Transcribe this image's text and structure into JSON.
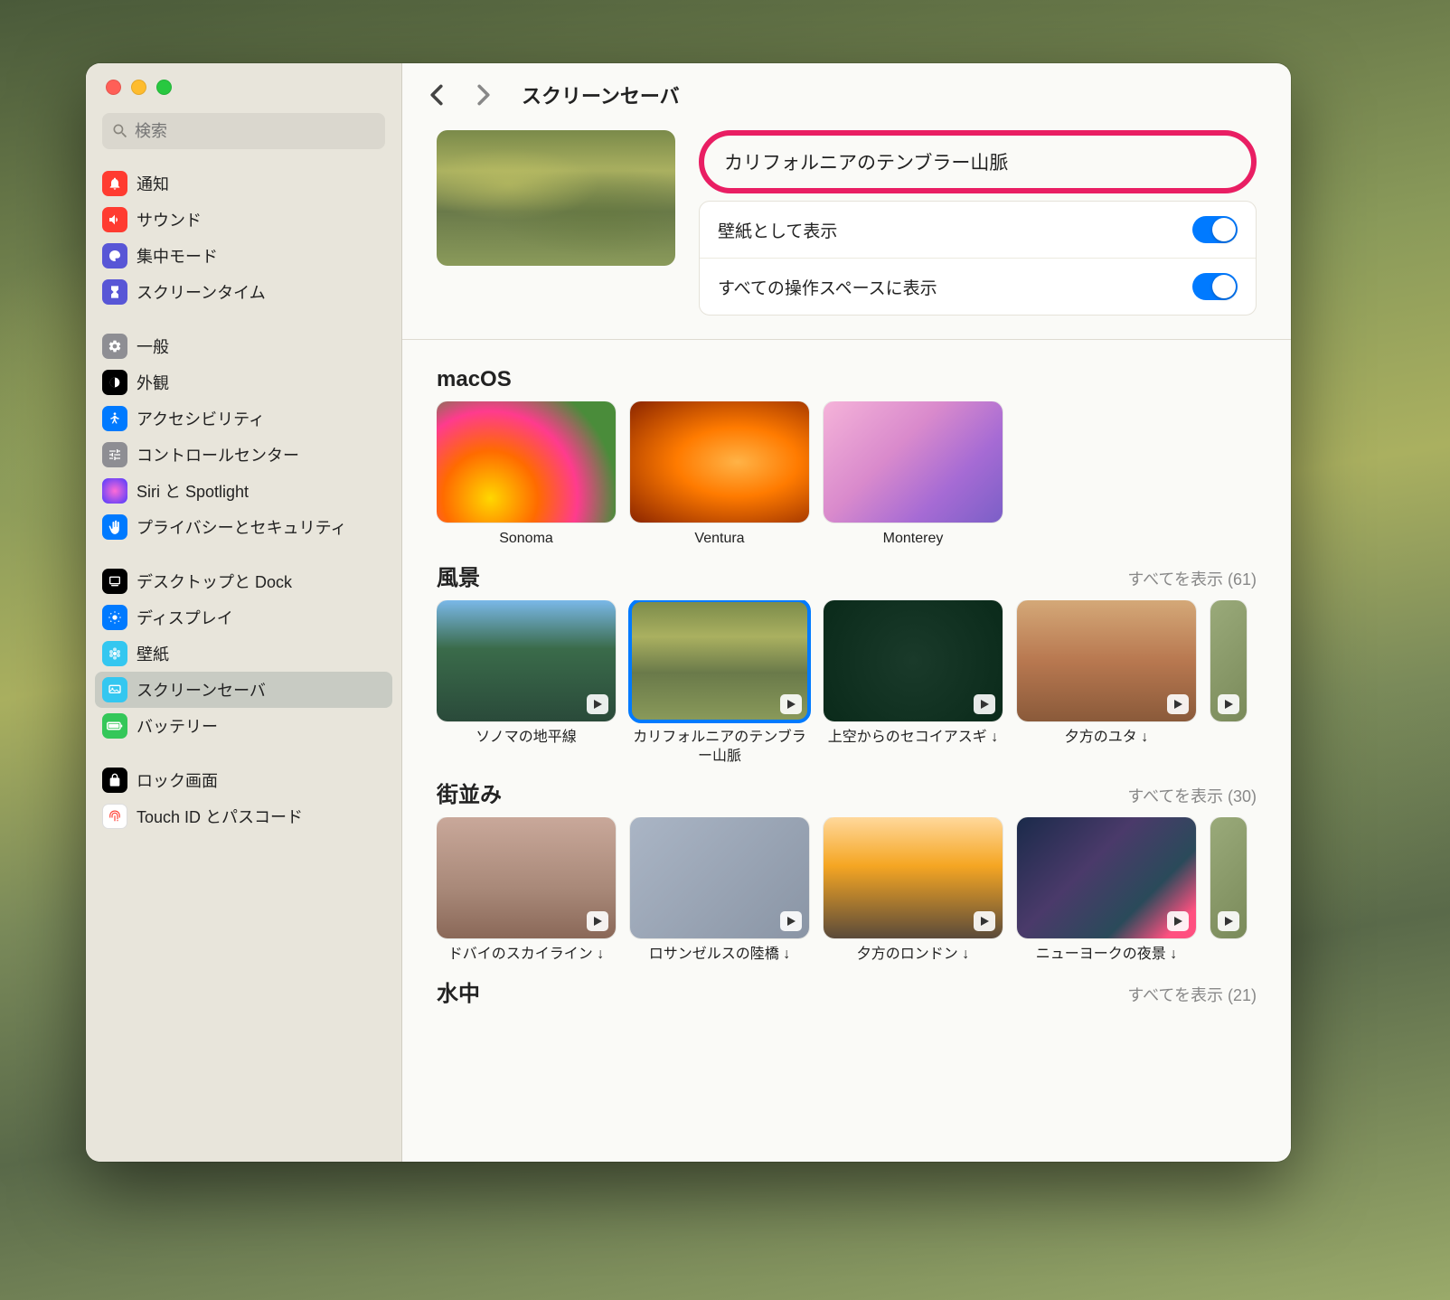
{
  "search": {
    "placeholder": "検索"
  },
  "header": {
    "title": "スクリーンセーバ"
  },
  "sidebar": {
    "items": [
      {
        "label": "通知",
        "icon_bg": "#ff3b30"
      },
      {
        "label": "サウンド",
        "icon_bg": "#ff3b30"
      },
      {
        "label": "集中モード",
        "icon_bg": "#5856d6"
      },
      {
        "label": "スクリーンタイム",
        "icon_bg": "#5856d6"
      },
      {
        "label": "一般",
        "icon_bg": "#8e8e93"
      },
      {
        "label": "外観",
        "icon_bg": "#000000"
      },
      {
        "label": "アクセシビリティ",
        "icon_bg": "#007aff"
      },
      {
        "label": "コントロールセンター",
        "icon_bg": "#8e8e93"
      },
      {
        "label": "Siri と Spotlight",
        "icon_bg": "#000000"
      },
      {
        "label": "プライバシーとセキュリティ",
        "icon_bg": "#007aff"
      },
      {
        "label": "デスクトップと Dock",
        "icon_bg": "#000000"
      },
      {
        "label": "ディスプレイ",
        "icon_bg": "#007aff"
      },
      {
        "label": "壁紙",
        "icon_bg": "#34c7f0"
      },
      {
        "label": "スクリーンセーバ",
        "icon_bg": "#34c7f0"
      },
      {
        "label": "バッテリー",
        "icon_bg": "#34c759"
      },
      {
        "label": "ロック画面",
        "icon_bg": "#000000"
      },
      {
        "label": "Touch ID とパスコード",
        "icon_bg": "#ffffff"
      }
    ]
  },
  "selected_name": "カリフォルニアのテンブラー山脈",
  "options": {
    "show_as_wallpaper": "壁紙として表示",
    "show_on_all_spaces": "すべての操作スペースに表示"
  },
  "sections": {
    "macos": {
      "title": "macOS",
      "items": [
        {
          "label": "Sonoma"
        },
        {
          "label": "Ventura"
        },
        {
          "label": "Monterey"
        }
      ]
    },
    "landscape": {
      "title": "風景",
      "show_all": "すべてを表示 (61)",
      "items": [
        {
          "label": "ソノマの地平線"
        },
        {
          "label": "カリフォルニアのテンブラー山脈"
        },
        {
          "label": "上空からのセコイアスギ ↓"
        },
        {
          "label": "夕方のユタ ↓"
        }
      ]
    },
    "cityscape": {
      "title": "街並み",
      "show_all": "すべてを表示 (30)",
      "items": [
        {
          "label": "ドバイのスカイライン ↓"
        },
        {
          "label": "ロサンゼルスの陸橋 ↓"
        },
        {
          "label": "夕方のロンドン ↓"
        },
        {
          "label": "ニューヨークの夜景 ↓"
        }
      ]
    },
    "underwater": {
      "title": "水中",
      "show_all": "すべてを表示 (21)"
    }
  }
}
